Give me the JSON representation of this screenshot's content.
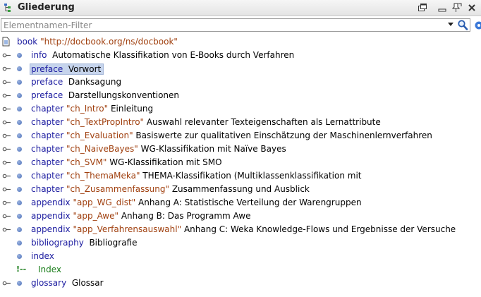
{
  "panel": {
    "title": "Gliederung",
    "filter_placeholder": "Elementnamen-Filter",
    "filter_value": ""
  },
  "tree": {
    "root": {
      "name": "book",
      "attr": "\"http://docbook.org/ns/docbook\""
    },
    "rows": [
      {
        "name": "info",
        "attr": "",
        "text": "Automatische Klassifikation von E-Books durch Verfahren"
      },
      {
        "name": "preface",
        "attr": "",
        "text": "Vorwort",
        "selected": true
      },
      {
        "name": "preface",
        "attr": "",
        "text": "Danksagung"
      },
      {
        "name": "preface",
        "attr": "",
        "text": "Darstellungskonventionen"
      },
      {
        "name": "chapter",
        "attr": "\"ch_Intro\"",
        "text": "Einleitung"
      },
      {
        "name": "chapter",
        "attr": "\"ch_TextPropIntro\"",
        "text": "Auswahl relevanter Texteigenschaften als Lernattribute"
      },
      {
        "name": "chapter",
        "attr": "\"ch_Evaluation\"",
        "text": "Basiswerte zur qualitativen Einschätzung der Maschinenlernverfahren"
      },
      {
        "name": "chapter",
        "attr": "\"ch_NaiveBayes\"",
        "text": "WG-Klassifikation mit Naïve Bayes"
      },
      {
        "name": "chapter",
        "attr": "\"ch_SVM\"",
        "text": "WG-Klassifikation mit SMO"
      },
      {
        "name": "chapter",
        "attr": "\"ch_ThemaMeka\"",
        "text": "THEMA-Klassifikation (Multiklassenklassifikation mit"
      },
      {
        "name": "chapter",
        "attr": "\"ch_Zusammenfassung\"",
        "text": "Zusammenfassung und Ausblick"
      },
      {
        "name": "appendix",
        "attr": "\"app_WG_dist\"",
        "text": "Anhang A: Statistische Verteilung der Warengruppen"
      },
      {
        "name": "appendix",
        "attr": "\"app_Awe\"",
        "text": "Anhang B: Das Programm Awe"
      },
      {
        "name": "appendix",
        "attr": "\"app_Verfahrensauswahl\"",
        "text": "Anhang C: Weka Knowledge-Flows und Ergebnisse der Versuche"
      },
      {
        "name": "bibliography",
        "attr": "",
        "text": "Bibliografie"
      },
      {
        "name": "index",
        "attr": "",
        "text": ""
      },
      {
        "comment": "Index"
      },
      {
        "name": "glossary",
        "attr": "",
        "text": "Glossar"
      }
    ]
  }
}
